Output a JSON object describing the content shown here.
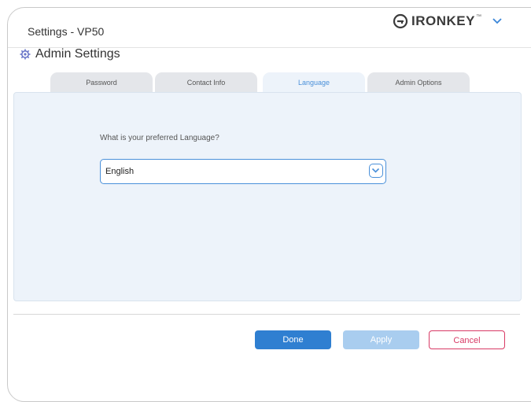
{
  "window": {
    "title": "Settings - VP50"
  },
  "brand": {
    "name": "IRONKEY",
    "trademark": "™"
  },
  "section": {
    "title": "Admin Settings"
  },
  "tabs": [
    {
      "label": "Password",
      "active": false
    },
    {
      "label": "Contact Info",
      "active": false
    },
    {
      "label": "Language",
      "active": true
    },
    {
      "label": "Admin Options",
      "active": false
    }
  ],
  "language": {
    "question": "What is your preferred Language?",
    "selected": "English"
  },
  "buttons": {
    "done": "Done",
    "apply": "Apply",
    "cancel": "Cancel"
  },
  "colors": {
    "accent": "#2f7fd1",
    "cancel": "#d83a65",
    "panel": "#edf3fa"
  },
  "icons": [
    "key-ring-icon",
    "chevron-down-icon",
    "gear-icon",
    "dropdown-chevron-icon"
  ]
}
